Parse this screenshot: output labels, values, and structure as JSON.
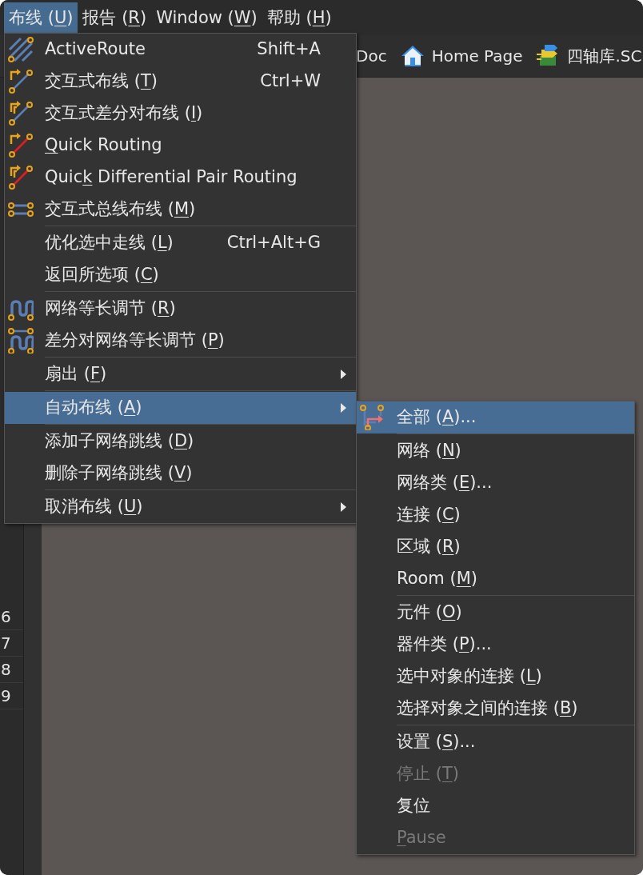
{
  "menubar": [
    {
      "label": {
        "pre": "布线 (",
        "key": "U",
        "post": ")"
      },
      "selected": true
    },
    {
      "label": {
        "pre": "报告 (",
        "key": "R",
        "post": ")"
      },
      "selected": false
    },
    {
      "label": {
        "pre": "Window (",
        "key": "W",
        "post": ")"
      },
      "selected": false
    },
    {
      "label": {
        "pre": "帮助 (",
        "key": "H",
        "post": ")"
      },
      "selected": false
    }
  ],
  "tabs": [
    {
      "kind": "text",
      "label": "Doc"
    },
    {
      "kind": "home",
      "label": "Home Page"
    },
    {
      "kind": "library",
      "label": "四轴库.SC"
    }
  ],
  "line_numbers": [
    "6",
    "7",
    "8",
    "9"
  ],
  "menu": {
    "groups": [
      [
        {
          "kind": "active-route",
          "label": {
            "pre": "ActiveRoute"
          },
          "shortcut": "Shift+A",
          "submenu": false,
          "selected": false
        },
        {
          "kind": "interactive",
          "label": {
            "pre": "交互式布线 (",
            "key": "T",
            "post": ")"
          },
          "shortcut": "Ctrl+W",
          "submenu": false,
          "selected": false
        },
        {
          "kind": "diff-pair",
          "label": {
            "pre": "交互式差分对布线 (",
            "key": "I",
            "post": ")"
          },
          "submenu": false,
          "selected": false
        },
        {
          "kind": "quick",
          "label": {
            "key": "Q",
            "post": "uick Routing"
          },
          "submenu": false,
          "selected": false
        },
        {
          "kind": "quick-diff",
          "label": {
            "pre": "Quic",
            "key": "k",
            "post": " Differential Pair Routing"
          },
          "submenu": false,
          "selected": false
        },
        {
          "kind": "bus",
          "label": {
            "pre": "交互式总线布线 (",
            "key": "M",
            "post": ")"
          },
          "submenu": false,
          "selected": false
        }
      ],
      [
        {
          "kind": "plain",
          "label": {
            "pre": "优化选中走线 (",
            "key": "L",
            "post": ")"
          },
          "shortcut": "Ctrl+Alt+G",
          "submenu": false,
          "selected": false
        },
        {
          "kind": "plain",
          "label": {
            "pre": "返回所选项 (",
            "key": "C",
            "post": ")"
          },
          "submenu": false,
          "selected": false
        }
      ],
      [
        {
          "kind": "tune",
          "label": {
            "pre": "网络等长调节 (",
            "key": "R",
            "post": ")"
          },
          "submenu": false,
          "selected": false
        },
        {
          "kind": "diff-tune",
          "label": {
            "pre": "差分对网络等长调节 (",
            "key": "P",
            "post": ")"
          },
          "submenu": false,
          "selected": false
        }
      ],
      [
        {
          "kind": "plain",
          "label": {
            "pre": "扇出 (",
            "key": "F",
            "post": ")"
          },
          "submenu": true,
          "selected": false
        }
      ],
      [
        {
          "kind": "plain",
          "label": {
            "pre": "自动布线 (",
            "key": "A",
            "post": ")"
          },
          "submenu": true,
          "selected": true
        }
      ],
      [
        {
          "kind": "plain",
          "label": {
            "pre": "添加子网络跳线 (",
            "key": "D",
            "post": ")"
          },
          "submenu": false,
          "selected": false
        },
        {
          "kind": "plain",
          "label": {
            "pre": "删除子网络跳线 (",
            "key": "V",
            "post": ")"
          },
          "submenu": false,
          "selected": false
        }
      ],
      [
        {
          "kind": "plain",
          "label": {
            "pre": "取消布线 (",
            "key": "U",
            "post": ")"
          },
          "submenu": true,
          "selected": false
        }
      ]
    ]
  },
  "submenu": {
    "groups": [
      [
        {
          "kind": "route-all",
          "label": {
            "pre": "全部 (",
            "key": "A",
            "post": ")..."
          },
          "selected": true,
          "disabled": false
        }
      ],
      [
        {
          "kind": "plain",
          "label": {
            "pre": "网络 (",
            "key": "N",
            "post": ")"
          },
          "selected": false,
          "disabled": false
        },
        {
          "kind": "plain",
          "label": {
            "pre": "网络类 (",
            "key": "E",
            "post": ")..."
          },
          "selected": false,
          "disabled": false
        },
        {
          "kind": "plain",
          "label": {
            "pre": "连接 (",
            "key": "C",
            "post": ")"
          },
          "selected": false,
          "disabled": false
        },
        {
          "kind": "plain",
          "label": {
            "pre": "区域 (",
            "key": "R",
            "post": ")"
          },
          "selected": false,
          "disabled": false
        },
        {
          "kind": "plain",
          "label": {
            "pre": "Room (",
            "key": "M",
            "post": ")"
          },
          "selected": false,
          "disabled": false
        }
      ],
      [
        {
          "kind": "plain",
          "label": {
            "pre": "元件 (",
            "key": "O",
            "post": ")"
          },
          "selected": false,
          "disabled": false
        },
        {
          "kind": "plain",
          "label": {
            "pre": "器件类 (",
            "key": "P",
            "post": ")..."
          },
          "selected": false,
          "disabled": false
        },
        {
          "kind": "plain",
          "label": {
            "pre": "选中对象的连接 (",
            "key": "L",
            "post": ")"
          },
          "selected": false,
          "disabled": false
        },
        {
          "kind": "plain",
          "label": {
            "pre": "选择对象之间的连接 (",
            "key": "B",
            "post": ")"
          },
          "selected": false,
          "disabled": false
        }
      ],
      [
        {
          "kind": "plain",
          "label": {
            "pre": "设置 (",
            "key": "S",
            "post": ")..."
          },
          "selected": false,
          "disabled": false
        },
        {
          "kind": "plain",
          "label": {
            "pre": "停止 (",
            "key": "T",
            "post": ")"
          },
          "selected": false,
          "disabled": true
        },
        {
          "kind": "plain",
          "label": {
            "pre": "复位"
          },
          "selected": false,
          "disabled": false
        },
        {
          "kind": "plain",
          "label": {
            "key": "P",
            "post": "ause"
          },
          "selected": false,
          "disabled": true
        }
      ]
    ]
  }
}
